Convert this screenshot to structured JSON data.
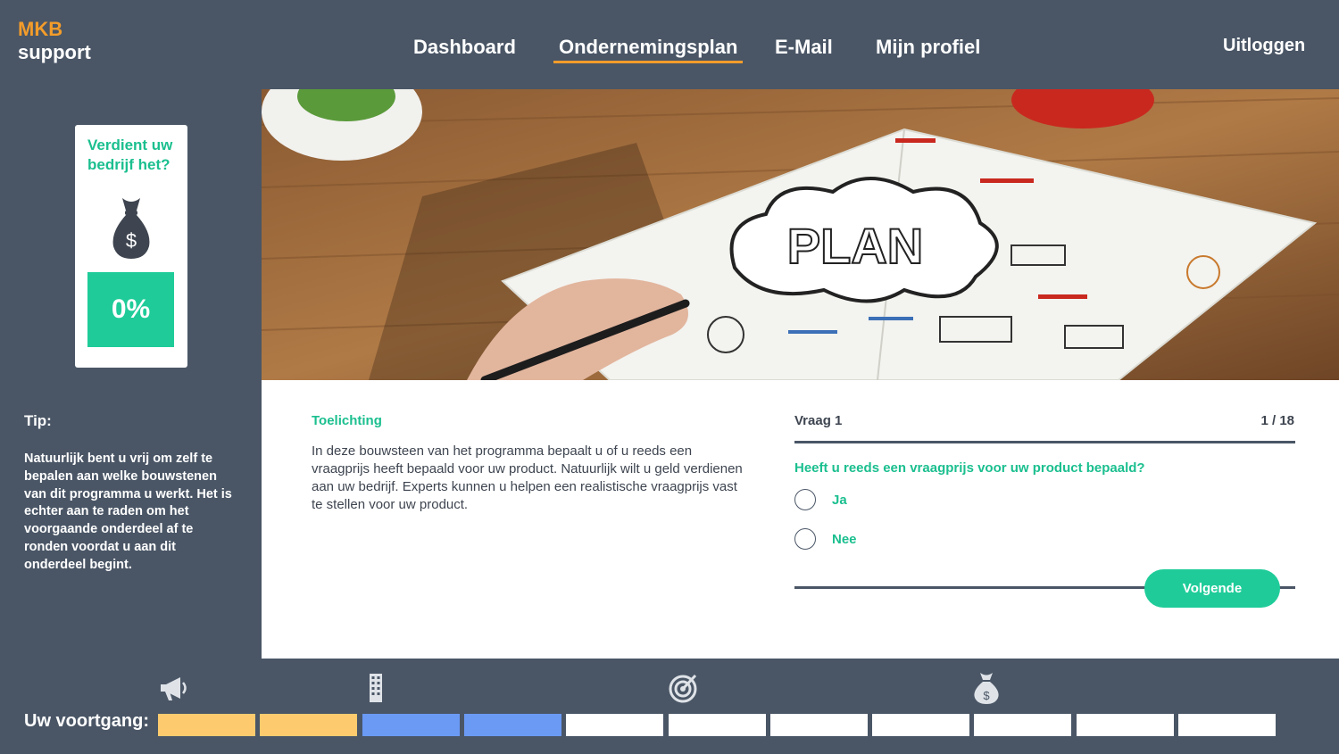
{
  "header": {
    "logo_line1": "MKB",
    "logo_line2": "support",
    "nav": [
      {
        "label": "Dashboard"
      },
      {
        "label": "Ondernemingsplan",
        "active": true
      },
      {
        "label": "E-Mail"
      },
      {
        "label": "Mijn profiel"
      }
    ],
    "logout": "Uitloggen"
  },
  "sidebar": {
    "card_title": "Verdient uw bedrijf het?",
    "card_icon": "money-bag-dollar-icon",
    "percentage": "0%",
    "tip_title": "Tip:",
    "tip_text": "Natuurlijk bent u vrij om zelf te bepalen aan welke bouwstenen van dit programma u werkt. Het is echter aan te raden om het voorgaande onderdeel af te ronden voordat u aan dit onderdeel begint."
  },
  "hero": {
    "notebook_word": "PLAN"
  },
  "explanation": {
    "title": "Toelichting",
    "text": "In deze bouwsteen van het programma bepaalt u of u reeds een vraagprijs heeft bepaald voor uw product. Natuurlijk wilt u geld verdienen aan uw bedrijf. Experts kunnen u helpen een realistische vraagprijs vast te stellen voor uw product."
  },
  "question": {
    "label": "Vraag 1",
    "counter": "1 / 18",
    "text": "Heeft u reeds een vraagprijs voor uw product bepaald?",
    "options": [
      "Ja",
      "Nee"
    ],
    "next_button": "Volgende"
  },
  "progress": {
    "label": "Uw voortgang:",
    "icons": [
      "megaphone-icon",
      "building-icon",
      "target-icon",
      "money-bag-icon"
    ],
    "segments": [
      "completed",
      "completed",
      "in-progress",
      "in-progress",
      "todo",
      "todo",
      "todo",
      "todo",
      "todo",
      "todo",
      "todo"
    ],
    "colors": {
      "completed": "#fdcb6e",
      "in-progress": "#6b9af5",
      "todo": "#ffffff"
    }
  },
  "colors": {
    "background": "#4a5666",
    "accent": "#1fcc99",
    "brand_orange": "#f39c2a"
  }
}
